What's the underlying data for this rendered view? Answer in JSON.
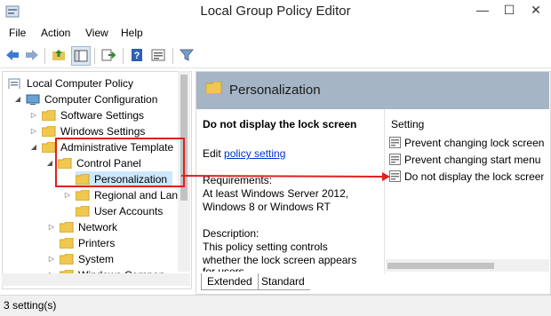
{
  "window": {
    "title": "Local Group Policy Editor",
    "minimize": "—",
    "maximize": "☐",
    "close": "✕"
  },
  "menu": [
    "File",
    "Action",
    "View",
    "Help"
  ],
  "toolbar": {
    "icons": [
      "back-arrow-icon",
      "forward-arrow-icon",
      "up-folder-icon",
      "show-hide-tree-icon",
      "export-list-icon",
      "help-icon",
      "properties-icon",
      "filter-icon"
    ]
  },
  "tree": {
    "items": [
      {
        "label": "Local Computer Policy",
        "level": 0,
        "expanded": true,
        "icon": "computer-policy-icon"
      },
      {
        "label": "Computer Configuration",
        "level": 1,
        "expanded": true,
        "icon": "computer-icon"
      },
      {
        "label": "Software Settings",
        "level": 2,
        "expanded": false,
        "icon": "folder-icon"
      },
      {
        "label": "Windows Settings",
        "level": 2,
        "expanded": false,
        "icon": "folder-icon"
      },
      {
        "label": "Administrative Template",
        "level": 2,
        "expanded": true,
        "icon": "folder-icon"
      },
      {
        "label": "Control Panel",
        "level": 3,
        "expanded": true,
        "icon": "folder-icon"
      },
      {
        "label": "Personalization",
        "level": 4,
        "selected": true,
        "icon": "folder-icon"
      },
      {
        "label": "Regional and Lan",
        "level": 4,
        "expanded": false,
        "icon": "folder-icon"
      },
      {
        "label": "User Accounts",
        "level": 4,
        "icon": "folder-icon"
      },
      {
        "label": "Network",
        "level": 3,
        "expanded": false,
        "icon": "folder-icon"
      },
      {
        "label": "Printers",
        "level": 3,
        "icon": "folder-icon"
      },
      {
        "label": "System",
        "level": 3,
        "expanded": false,
        "icon": "folder-icon"
      },
      {
        "label": "Windows Compon",
        "level": 3,
        "expanded": false,
        "icon": "folder-icon"
      }
    ]
  },
  "details": {
    "header_title": "Personalization",
    "policy_title": "Do not display the lock screen",
    "edit_prefix": "Edit",
    "edit_link": "policy setting",
    "requirements_label": "Requirements:",
    "requirements_1": "At least Windows Server 2012,",
    "requirements_2": "Windows 8 or Windows RT",
    "description_label": "Description:",
    "description_1": "This policy setting controls",
    "description_2": "whether the lock screen appears",
    "description_3": "for users."
  },
  "settings": {
    "column_header": "Setting",
    "rows": [
      {
        "label": "Prevent changing lock screen"
      },
      {
        "label": "Prevent changing start menu b"
      },
      {
        "label": "Do not display the lock screen",
        "highlighted": true
      }
    ]
  },
  "tabs": [
    {
      "label": "Extended",
      "active": true
    },
    {
      "label": "Standard",
      "active": false
    }
  ],
  "status": {
    "text": "3 setting(s)"
  },
  "colors": {
    "accent": "#a5b5c5",
    "annotation": "#e0201e",
    "link": "#0033cc",
    "selection": "#cce8ff"
  }
}
